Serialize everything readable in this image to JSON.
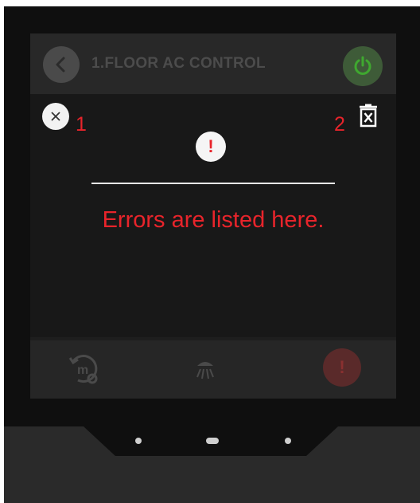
{
  "header": {
    "title": "1.FLOOR AC CONTROL"
  },
  "overlay": {
    "annotation_1": "1",
    "annotation_2": "2",
    "alert_symbol": "!",
    "error_message": "Errors are listed here."
  },
  "footer": {
    "error_symbol": "!"
  },
  "icons": {
    "back": "chevron-left-icon",
    "power": "power-icon",
    "close": "close-icon",
    "delete": "trash-icon",
    "alert": "exclamation-icon",
    "mode": "mode-settings-icon",
    "light": "light-icon"
  },
  "colors": {
    "accent_red": "#e8242b",
    "power_green": "#3e5b38",
    "screen_bg": "#1e1e1e",
    "overlay_bg": "#181818"
  }
}
